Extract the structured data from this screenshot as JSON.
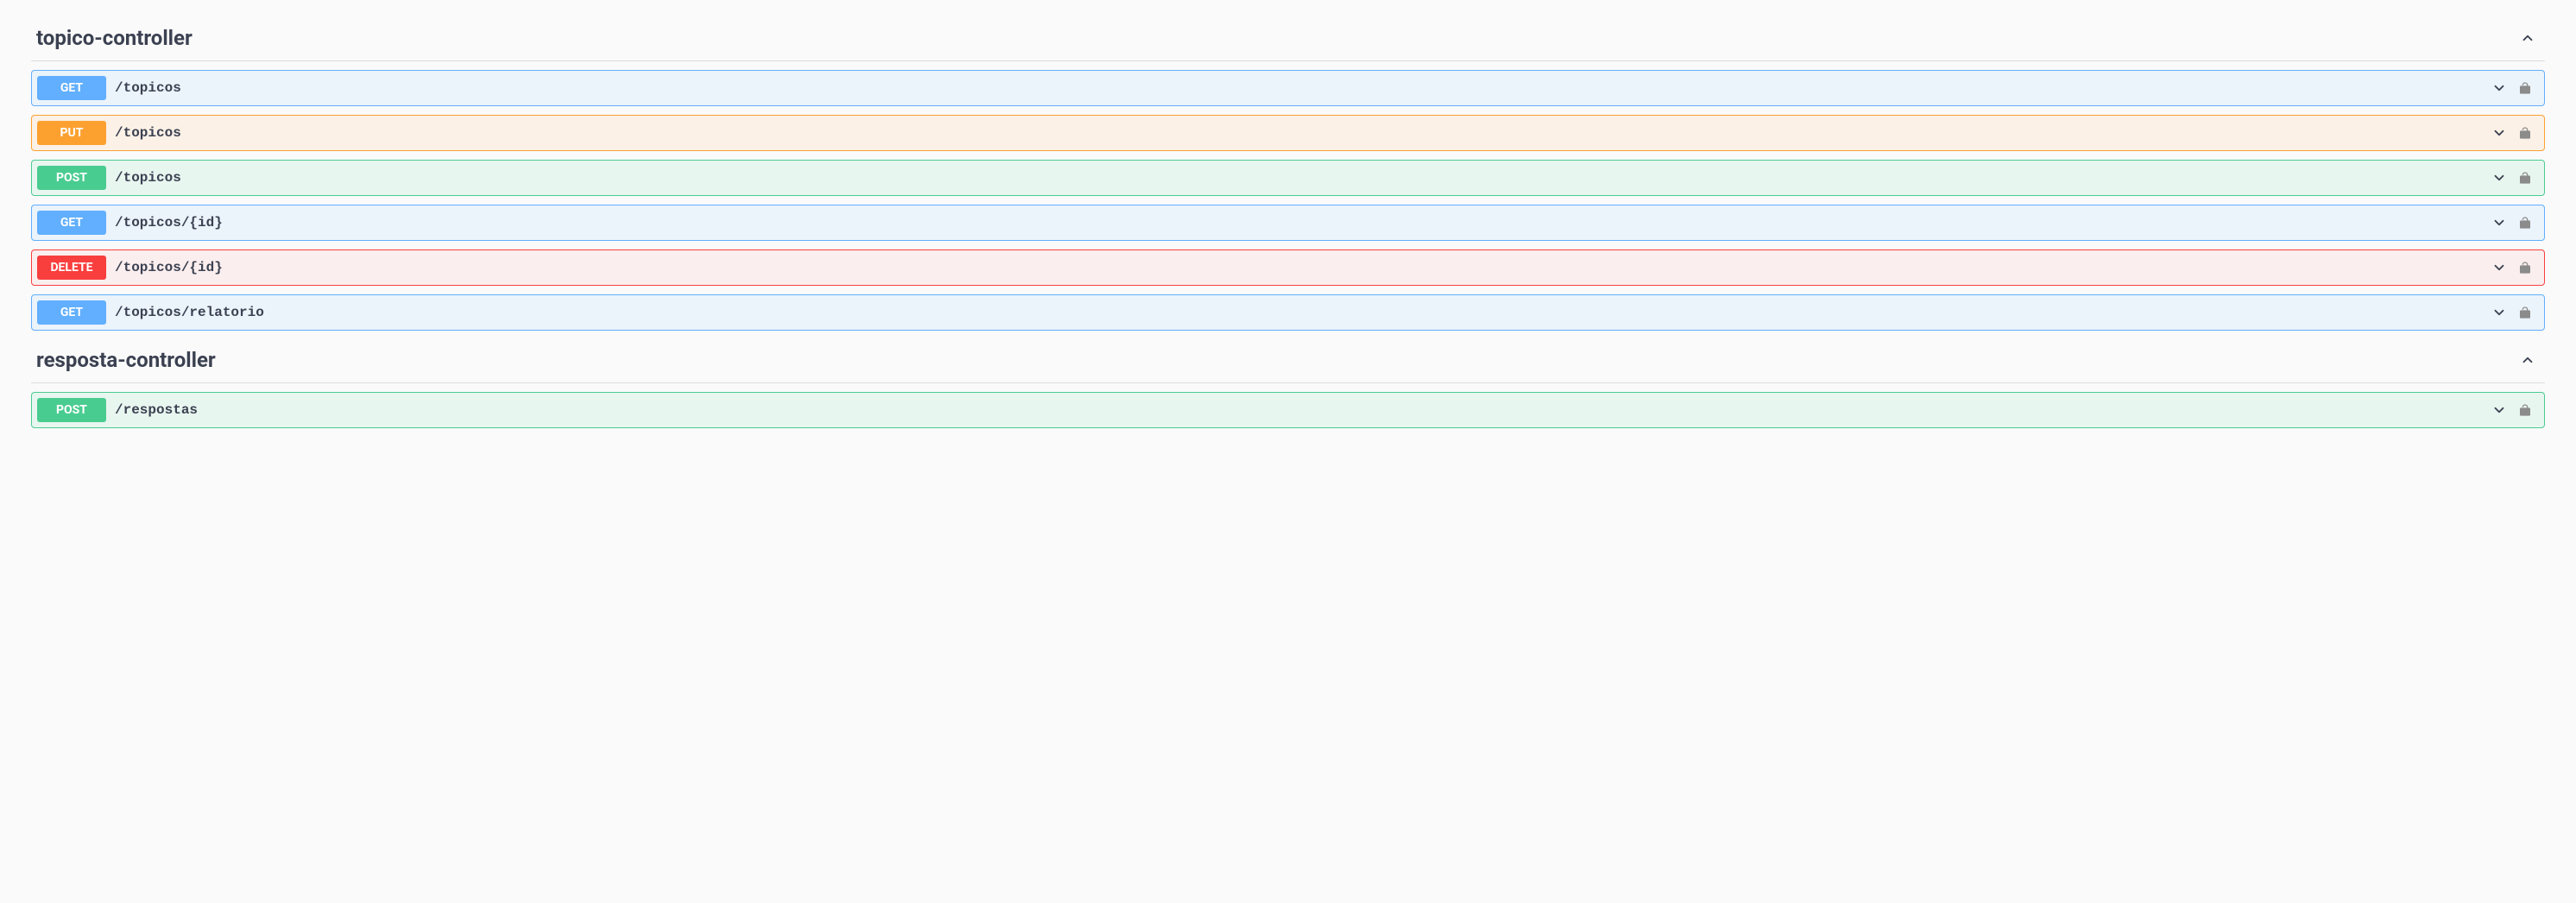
{
  "controllers": [
    {
      "name": "topico-controller",
      "endpoints": [
        {
          "method": "GET",
          "methodClass": "get",
          "path": "/topicos"
        },
        {
          "method": "PUT",
          "methodClass": "put",
          "path": "/topicos"
        },
        {
          "method": "POST",
          "methodClass": "post",
          "path": "/topicos"
        },
        {
          "method": "GET",
          "methodClass": "get",
          "path": "/topicos/{id}"
        },
        {
          "method": "DELETE",
          "methodClass": "delete",
          "path": "/topicos/{id}"
        },
        {
          "method": "GET",
          "methodClass": "get",
          "path": "/topicos/relatorio"
        }
      ]
    },
    {
      "name": "resposta-controller",
      "endpoints": [
        {
          "method": "POST",
          "methodClass": "post",
          "path": "/respostas"
        }
      ]
    }
  ]
}
